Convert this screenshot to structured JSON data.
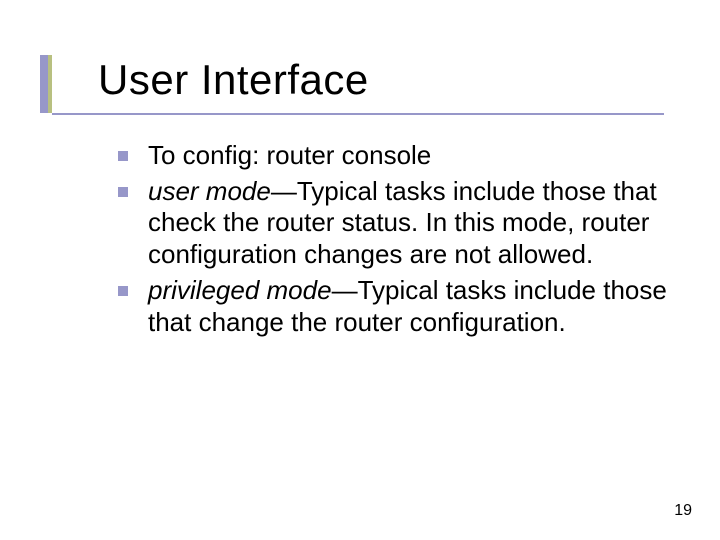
{
  "title": "User Interface",
  "bullets": [
    {
      "prefix": "",
      "rest": "To config: router console"
    },
    {
      "prefix": "user mode",
      "rest": "—Typical tasks include those that check the router status. In this mode, router configuration changes are not allowed."
    },
    {
      "prefix": "privileged mode",
      "rest": "—Typical tasks include those that change the router configuration."
    }
  ],
  "page_number": "19"
}
